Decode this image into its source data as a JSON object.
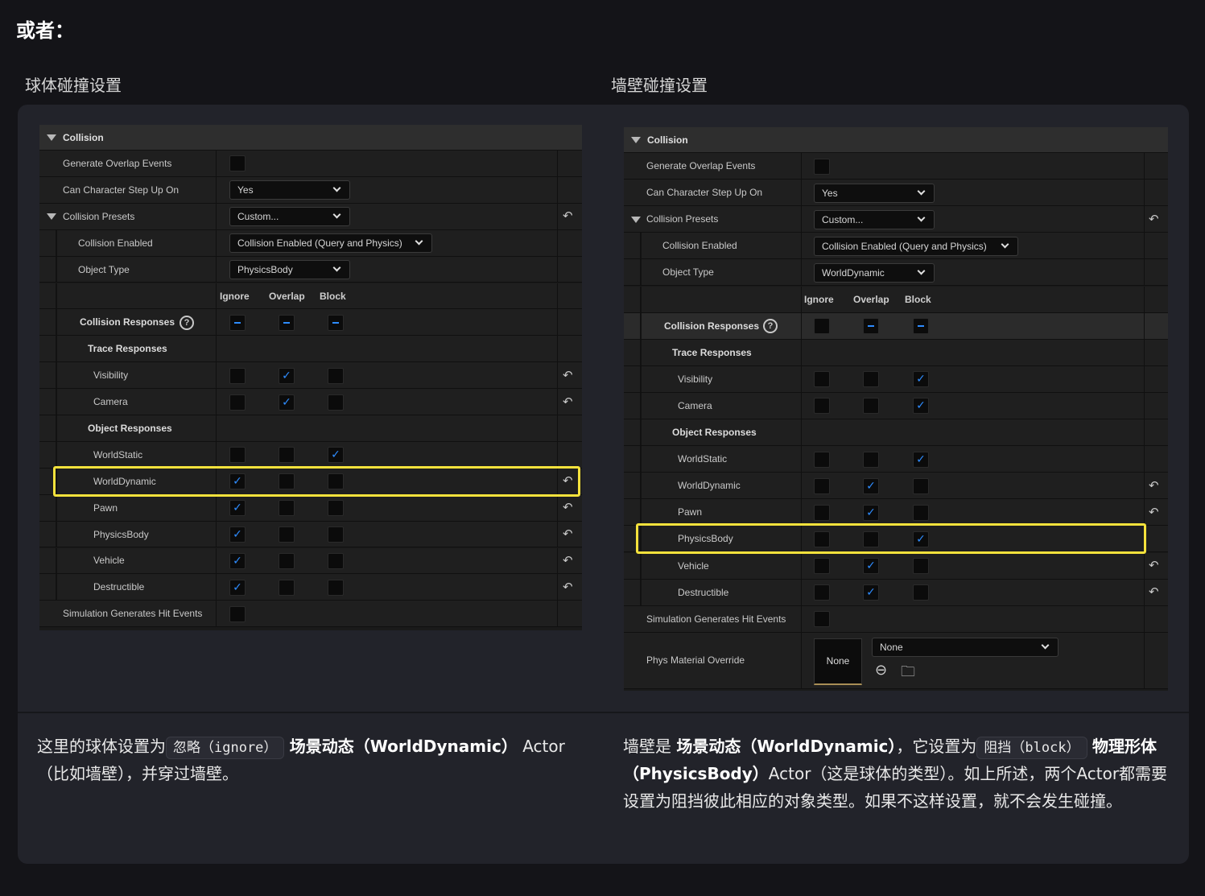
{
  "heading": "或者：",
  "left": {
    "title": "球体碰撞设置",
    "section": "Collision",
    "rows": {
      "gen_overlap": "Generate Overlap Events",
      "step_up": "Can Character Step Up On",
      "step_up_value": "Yes",
      "presets": "Collision Presets",
      "presets_value": "Custom...",
      "enabled": "Collision Enabled",
      "enabled_value": "Collision Enabled (Query and Physics)",
      "object_type": "Object Type",
      "object_type_value": "PhysicsBody",
      "col_ignore": "Ignore",
      "col_overlap": "Overlap",
      "col_block": "Block",
      "responses": "Collision Responses",
      "trace": "Trace Responses",
      "visibility": "Visibility",
      "camera": "Camera",
      "object": "Object Responses",
      "worldstatic": "WorldStatic",
      "worlddynamic": "WorldDynamic",
      "pawn": "Pawn",
      "physicsbody": "PhysicsBody",
      "vehicle": "Vehicle",
      "destructible": "Destructible",
      "sim_hit": "Simulation Generates Hit Events"
    },
    "highlight": "WorldDynamic",
    "desc": {
      "p1": "这里的球体设置为",
      "code": "忽略（ignore）",
      "b1": "场景动态（WorldDynamic）",
      "p2": "Actor",
      "p3": "（比如墙壁），并穿过墙壁。"
    }
  },
  "right": {
    "title": "墙壁碰撞设置",
    "section": "Collision",
    "rows": {
      "gen_overlap": "Generate Overlap Events",
      "step_up": "Can Character Step Up On",
      "step_up_value": "Yes",
      "presets": "Collision Presets",
      "presets_value": "Custom...",
      "enabled": "Collision Enabled",
      "enabled_value": "Collision Enabled (Query and Physics)",
      "object_type": "Object Type",
      "object_type_value": "WorldDynamic",
      "col_ignore": "Ignore",
      "col_overlap": "Overlap",
      "col_block": "Block",
      "responses": "Collision Responses",
      "trace": "Trace Responses",
      "visibility": "Visibility",
      "camera": "Camera",
      "object": "Object Responses",
      "worldstatic": "WorldStatic",
      "worlddynamic": "WorldDynamic",
      "pawn": "Pawn",
      "physicsbody": "PhysicsBody",
      "vehicle": "Vehicle",
      "destructible": "Destructible",
      "sim_hit": "Simulation Generates Hit Events",
      "phys_mat": "Phys Material Override",
      "phys_thumb": "None",
      "phys_value": "None"
    },
    "highlight": "PhysicsBody",
    "desc": {
      "p1": "墙壁是",
      "b1": "场景动态（WorldDynamic）",
      "p2": "，它设置为",
      "code": "阻挡（block）",
      "b2": "物理形体（PhysicsBody）",
      "p3": "Actor（这是球体的类型）。如上所述，两个Actor都需要设置为阻挡彼此相应的对象类型。如果不这样设置，就不会发生碰撞。"
    }
  },
  "icons": {
    "collapse": "triangle-down-icon",
    "reset": "reset-arrow-icon",
    "help": "question-circle-icon",
    "check": "checkmark-icon",
    "dropdown": "chevron-down-icon",
    "use_asset": "arrow-left-circle-icon",
    "browse_asset": "folder-search-icon"
  },
  "colors": {
    "accent": "#2e8cff",
    "highlight": "#f5e23c",
    "panel": "#1a1a1a"
  }
}
